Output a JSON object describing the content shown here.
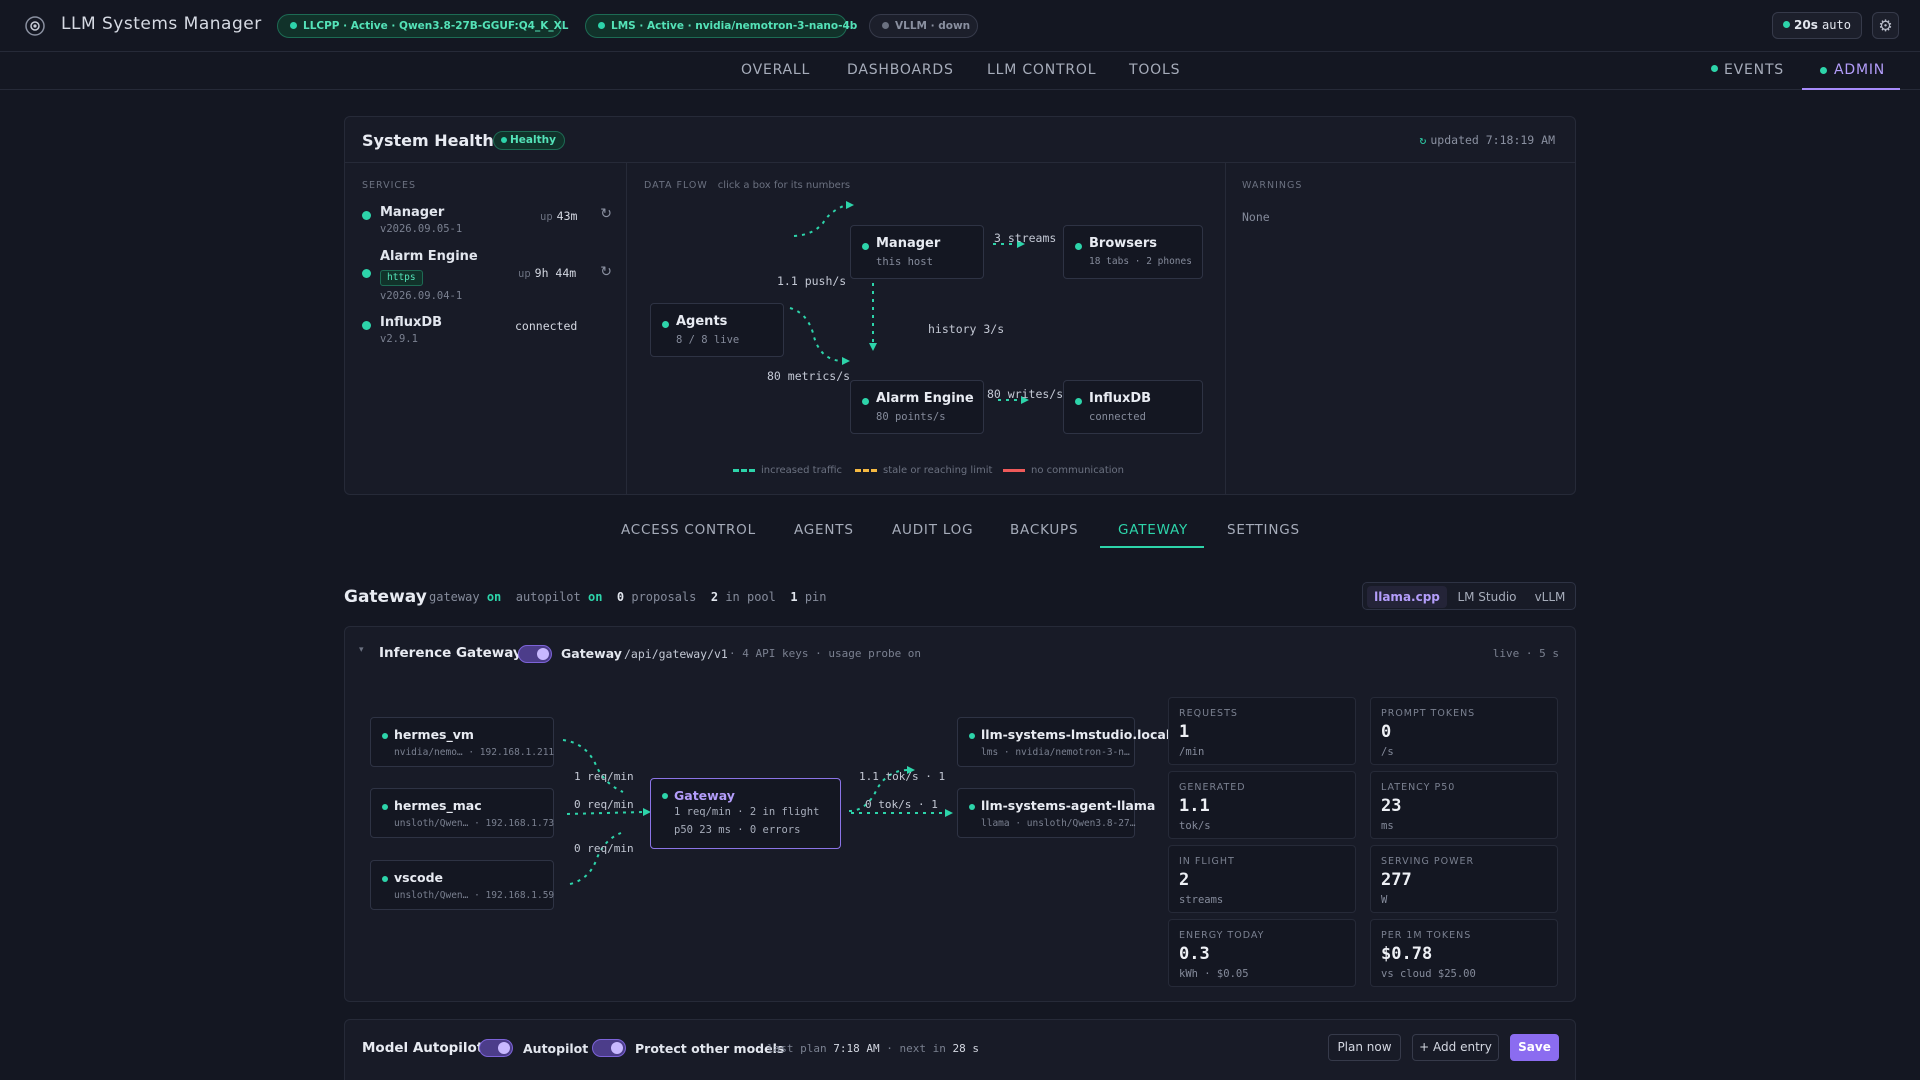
{
  "app": {
    "title": "LLM Systems Manager"
  },
  "status_pills": [
    {
      "label": "LLCPP · Active · Qwen3.8-27B-GGUF:Q4_K_XL",
      "state": "active"
    },
    {
      "label": "LMS · Active · nvidia/nemotron-3-nano-4b",
      "state": "active"
    },
    {
      "label": "VLLM · down",
      "state": "down"
    }
  ],
  "refresh": {
    "label": "20s",
    "mode": "auto"
  },
  "nav": {
    "tabs": [
      "OVERALL",
      "DASHBOARDS",
      "LLM CONTROL",
      "TOOLS"
    ],
    "events": "EVENTS",
    "admin": "ADMIN"
  },
  "health": {
    "title": "System Health",
    "badge": "Healthy",
    "updated": "updated 7:18:19 AM",
    "services_label": "SERVICES",
    "dataflow_label": "DATA FLOW",
    "dataflow_hint": "click a box for its numbers",
    "warnings_label": "WARNINGS",
    "warnings_text": "None",
    "services": [
      {
        "name": "Manager",
        "version": "v2026.09.05-1",
        "up_label": "up",
        "uptime": "43m"
      },
      {
        "name": "Alarm Engine",
        "tag": "https",
        "version": "v2026.09.04-1",
        "up_label": "up",
        "uptime": "9h 44m"
      },
      {
        "name": "InfluxDB",
        "version": "v2.9.1",
        "status": "connected"
      }
    ],
    "flow": {
      "agents": {
        "name": "Agents",
        "sub": "8 / 8 live"
      },
      "manager": {
        "name": "Manager",
        "sub": "this host"
      },
      "browsers": {
        "name": "Browsers",
        "sub": "18 tabs · 2 phones"
      },
      "alarm": {
        "name": "Alarm Engine",
        "sub": "80 points/s"
      },
      "influx": {
        "name": "InfluxDB",
        "sub": "connected"
      },
      "labels": {
        "push": "1.1 push/s",
        "streams": "3 streams",
        "history": "history 3/s",
        "metrics": "80 metrics/s",
        "writes": "80 writes/s"
      },
      "legend": [
        "increased traffic",
        "stale or reaching limit",
        "no communication"
      ]
    }
  },
  "subtabs": [
    "ACCESS CONTROL",
    "AGENTS",
    "AUDIT LOG",
    "BACKUPS",
    "GATEWAY",
    "SETTINGS"
  ],
  "gateway": {
    "title": "Gateway",
    "meta": {
      "gateway_k": "gateway",
      "gateway_v": "on",
      "autopilot_k": "autopilot",
      "autopilot_v": "on",
      "proposals_n": "0",
      "proposals_k": "proposals",
      "pool_n": "2",
      "pool_k": "in pool",
      "pin_n": "1",
      "pin_k": "pin"
    },
    "backends": [
      "llama.cpp",
      "LM Studio",
      "vLLM"
    ],
    "inference": {
      "title": "Inference Gateway",
      "toggle_label": "Gateway",
      "path": "/api/gateway/v1",
      "meta": "· 4 API keys · usage probe on",
      "live": "live · 5 s",
      "clients": [
        {
          "name": "hermes_vm",
          "sub": "nvidia/nemo… · 192.168.1.211",
          "rate": "1 req/min"
        },
        {
          "name": "hermes_mac",
          "sub": "unsloth/Qwen… · 192.168.1.73",
          "rate": "0 req/min"
        },
        {
          "name": "vscode",
          "sub": "unsloth/Qwen… · 192.168.1.59",
          "rate": "0 req/min"
        }
      ],
      "center": {
        "name": "Gateway",
        "line1": "1 req/min · 2 in flight",
        "line2": "p50 23 ms · 0 errors"
      },
      "upstreams": [
        {
          "name": "llm-systems-lmstudio.local",
          "sub": "lms · nvidia/nemotron-3-n…",
          "rate": "1.1 tok/s · 1"
        },
        {
          "name": "llm-systems-agent-llama",
          "sub": "llama · unsloth/Qwen3.8-27…",
          "rate": "0 tok/s · 1"
        }
      ],
      "metrics": [
        {
          "label": "REQUESTS",
          "value": "1",
          "unit": "/min"
        },
        {
          "label": "PROMPT TOKENS",
          "value": "0",
          "unit": "/s"
        },
        {
          "label": "GENERATED",
          "value": "1.1",
          "unit": "tok/s"
        },
        {
          "label": "LATENCY P50",
          "value": "23",
          "unit": "ms"
        },
        {
          "label": "IN FLIGHT",
          "value": "2",
          "unit": "streams"
        },
        {
          "label": "SERVING POWER",
          "value": "277",
          "unit": "W"
        },
        {
          "label": "ENERGY TODAY",
          "value": "0.3",
          "unit": "kWh · $0.05"
        },
        {
          "label": "PER 1M TOKENS",
          "value": "$0.78",
          "unit": "vs cloud $25.00"
        }
      ]
    }
  },
  "autopilot": {
    "title": "Model Autopilot",
    "toggle1": "Autopilot",
    "toggle2": "Protect other models",
    "last_plan_k": "last plan",
    "last_plan_v": "7:18 AM",
    "next_k": "· next in",
    "next_v": "28 s",
    "buttons": {
      "plan": "Plan now",
      "add": "+ Add entry",
      "save": "Save"
    }
  },
  "colors": {
    "accent": "#2dd4aa",
    "violet": "#a78bfa",
    "bg": "#141722",
    "card": "#181b27",
    "warn": "#f5b942",
    "error": "#ef5a5a"
  }
}
